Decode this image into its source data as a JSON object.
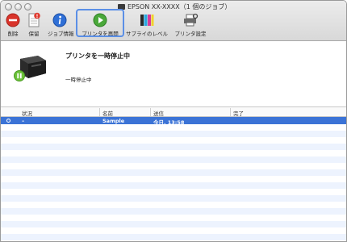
{
  "window": {
    "title": "EPSON XX-XXXX（1 個のジョブ）"
  },
  "toolbar": {
    "delete_label": "削除",
    "hold_label": "保留",
    "job_info_label": "ジョブ情報",
    "resume_label": "プリンタを再開",
    "supply_levels_label": "サプライのレベル",
    "printer_settings_label": "プリンタ設定",
    "hold_badge": "!"
  },
  "status": {
    "title": "プリンタを一時停止中",
    "subtitle": "一時停止中"
  },
  "job_table": {
    "columns": [
      "状況",
      "名前",
      "送信",
      "完了"
    ],
    "rows": [
      {
        "status": "–",
        "name": "Sample",
        "sent": "今日, 13:58",
        "completed": "",
        "selected": true
      }
    ]
  },
  "colors": {
    "selection": "#3b73d6",
    "highlight": "#5b8fe6",
    "pause_badge": "#6cc23a"
  }
}
